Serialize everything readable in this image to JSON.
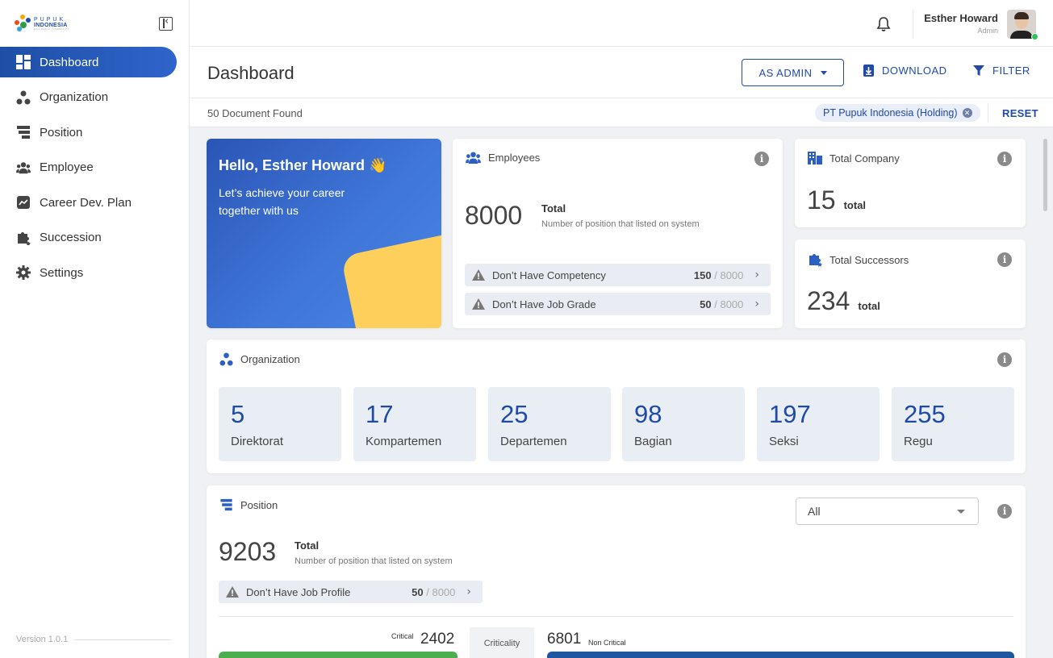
{
  "sidebar": {
    "logo": {
      "line1": "PUPUK",
      "line2": "INDONESIA",
      "line3": "HOLDING COMPANY"
    },
    "items": [
      {
        "label": "Dashboard",
        "icon": "dashboard-icon",
        "active": true
      },
      {
        "label": "Organization",
        "icon": "organization-icon"
      },
      {
        "label": "Position",
        "icon": "position-icon"
      },
      {
        "label": "Employee",
        "icon": "employee-icon"
      },
      {
        "label": "Career Dev. Plan",
        "icon": "career-icon"
      },
      {
        "label": "Succession",
        "icon": "puzzle-icon"
      },
      {
        "label": "Settings",
        "icon": "gear-icon"
      }
    ],
    "version": "Version 1.0.1"
  },
  "header": {
    "user_name": "Esther Howard",
    "user_role": "Admin",
    "status_color": "#2ec55a"
  },
  "page": {
    "title": "Dashboard",
    "role_button": "AS ADMIN",
    "download_label": "DOWNLOAD",
    "filter_label": "FILTER",
    "doc_count": "50 Document Found",
    "active_filter": "PT Pupuk Indonesia (Holding)",
    "reset_label": "RESET"
  },
  "hello": {
    "title": "Hello, Esther Howard 👋",
    "subtitle": "Let’s achieve your career together with us"
  },
  "employees": {
    "title": "Employees",
    "value": "8000",
    "total_label": "Total",
    "total_sub": "Number of position that listed on system",
    "warnings": [
      {
        "label": "Don’t Have Competency",
        "count": "150",
        "of": "8000"
      },
      {
        "label": "Don’t Have Job Grade",
        "count": "50",
        "of": "8000"
      }
    ]
  },
  "total_company": {
    "title": "Total Company",
    "value": "15",
    "unit": "total"
  },
  "total_successors": {
    "title": "Total Successors",
    "value": "234",
    "unit": "total"
  },
  "organization": {
    "title": "Organization",
    "items": [
      {
        "value": "5",
        "label": "Direktorat"
      },
      {
        "value": "17",
        "label": "Kompartemen"
      },
      {
        "value": "25",
        "label": "Departemen"
      },
      {
        "value": "98",
        "label": "Bagian"
      },
      {
        "value": "197",
        "label": "Seksi"
      },
      {
        "value": "255",
        "label": "Regu"
      }
    ]
  },
  "position": {
    "title": "Position",
    "select_value": "All",
    "value": "9203",
    "total_label": "Total",
    "total_sub": "Number of position that listed on system",
    "warning": {
      "label": "Don’t Have Job Profile",
      "count": "50",
      "of": "8000"
    },
    "critical_label": "Critical",
    "critical_value": "2402",
    "criticality_label": "Criticality",
    "non_critical_value": "6801",
    "non_critical_label": "Non Critical",
    "colors": {
      "critical": "#4bae4f",
      "non_critical": "#1e56a0"
    }
  },
  "colors": {
    "brand": "#1f4aa8",
    "accent_yellow": "#ffcf5c"
  }
}
